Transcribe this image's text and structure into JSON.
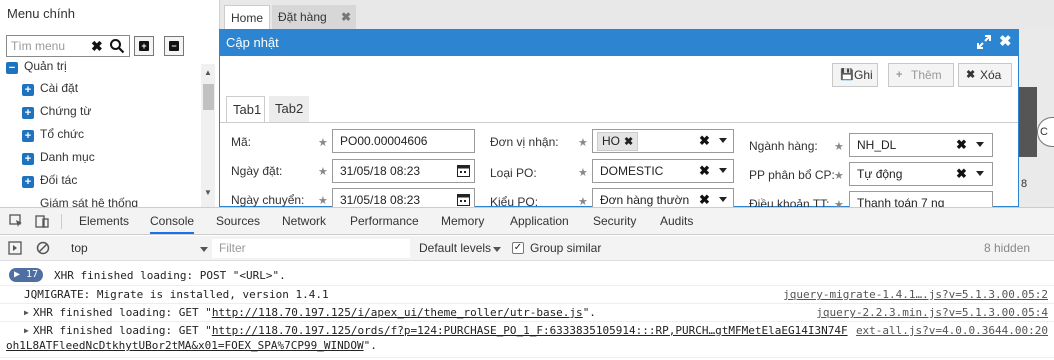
{
  "sidebar": {
    "title": "Menu chính",
    "search_placeholder": "Tìm menu",
    "expand_symbol": "+",
    "collapse_symbol": "−",
    "items": [
      "Quản trị",
      "Cài đặt",
      "Chứng từ",
      "Tổ chức",
      "Danh mục",
      "Đối tác",
      "Giám sát hệ thống"
    ]
  },
  "tabs": {
    "home": "Home",
    "order": "Đặt hàng",
    "close_symbol": "✖"
  },
  "dialog": {
    "title": "Cập nhật",
    "toolbar": {
      "save": "Ghi",
      "add": "Thêm",
      "delete": "Xóa"
    },
    "form_tabs": [
      "Tab1",
      "Tab2"
    ],
    "fields": {
      "ma": {
        "label": "Mã:",
        "value": "PO00.00004606"
      },
      "ngay_dat": {
        "label": "Ngày đặt:",
        "value": "31/05/18 08:23"
      },
      "ngay_chuyen": {
        "label": "Ngày chuyển:",
        "value": "31/05/18 08:23"
      },
      "don_vi_nhan": {
        "label": "Đơn vị nhận:",
        "chip": "HO"
      },
      "loai_po": {
        "label": "Loại PO:",
        "value": "DOMESTIC"
      },
      "kieu_po": {
        "label": "Kiểu PO:",
        "value": "Đơn hàng thườn"
      },
      "nganh_hang": {
        "label": "Ngành hàng:",
        "value": "NH_DL"
      },
      "pp_phan_bo": {
        "label": "PP phân bổ CP:",
        "value": "Tự động"
      },
      "dieu_khoan": {
        "label": "Điều khoản TT:",
        "value": "Thanh toán 7 ng"
      }
    },
    "star": "★"
  },
  "right_panel": {
    "circle_text": "C",
    "number": "8"
  },
  "devtools": {
    "tabs": [
      "Elements",
      "Console",
      "Sources",
      "Network",
      "Performance",
      "Memory",
      "Application",
      "Security",
      "Audits"
    ],
    "context": "top",
    "filter_placeholder": "Filter",
    "levels": "Default levels",
    "group_similar": "Group similar",
    "hidden_count": "8 hidden",
    "console": {
      "row1": {
        "badge": "17",
        "msg": "XHR finished loading: POST \"<URL>\"."
      },
      "row2": {
        "msg": "JQMIGRATE: Migrate is installed, version 1.4.1",
        "src": "jquery-migrate-1.4.1….js?v=5.1.3.00.05:2"
      },
      "row3": {
        "pre": "XHR finished loading: GET \"",
        "link": "http://118.70.197.125/i/apex_ui/theme_roller/utr-base.js",
        "post": "\".",
        "src": "jquery-2.2.3.min.js?v=5.1.3.00.05:4"
      },
      "row4": {
        "pre": "XHR finished loading: GET \"",
        "link": "http://118.70.197.125/ords/f?p=124:PURCHASE_PO_1_F:6333835105914:::RP,PURCH…gtMFMetElaEG14I3N74F",
        "src": "ext-all.js?v=4.0.0.3644.00:20",
        "line2": "oh1L8ATFleedNcDtkhytUBor2tMA&x01=FOEX_SPA%7CP99_WINDOW",
        "line2_post": "\"."
      }
    }
  }
}
